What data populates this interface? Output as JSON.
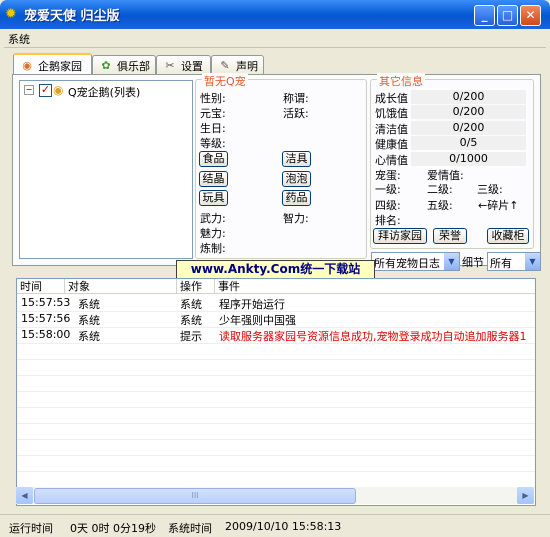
{
  "window": {
    "title": "宠爱天使 归尘版",
    "app_icon": "gear-icon"
  },
  "menu": {
    "items": [
      "系统"
    ]
  },
  "tabs": [
    {
      "label": "企鹅家园",
      "icon": "penguin-icon"
    },
    {
      "label": "俱乐部",
      "icon": "flower-icon"
    },
    {
      "label": "设置",
      "icon": "tools-icon"
    },
    {
      "label": "声明",
      "icon": "document-icon"
    }
  ],
  "tree": {
    "root_label": "Q宠企鹅(列表)"
  },
  "pet": {
    "group_title": "暂无Q宠",
    "fields": {
      "gender": "性别:",
      "title": "称谓:",
      "yuanbao": "元宝:",
      "activity": "活跃:",
      "birthday": "生日:",
      "level": "等级:",
      "force": "武力:",
      "intellect": "智力:",
      "charm": "魅力:",
      "refine": "炼制:"
    },
    "actions": {
      "food": "食品",
      "clean": "洁具",
      "crystal": "结晶",
      "bubble": "泡泡",
      "toy": "玩具",
      "medicine": "药品"
    }
  },
  "other": {
    "group_title": "其它信息",
    "stats": [
      {
        "label": "成长值",
        "value": "0/200"
      },
      {
        "label": "饥饿值",
        "value": "0/200"
      },
      {
        "label": "清洁值",
        "value": "0/200"
      },
      {
        "label": "健康值",
        "value": "0/5"
      },
      {
        "label": "心情值",
        "value": "0/1000"
      }
    ],
    "status_label": "宠蛋:",
    "love_label": "爱情值:",
    "grade1": "一级:",
    "grade2": "二级:",
    "grade3": "三级:",
    "grade4": "四级:",
    "grade5": "五级:",
    "shard": "←碎片↑",
    "rank": "排名:",
    "buttons": {
      "visit": "拜访家园",
      "honor": "荣誉",
      "cabinet": "收藏柜"
    }
  },
  "watermark": "www.Ankty.Com统一下载站",
  "filters": {
    "log_type": "所有宠物日志",
    "detail_label": "细节",
    "detail_value": "所有"
  },
  "log": {
    "columns": [
      "时间",
      "对象",
      "操作",
      "事件"
    ],
    "rows": [
      {
        "time": "15:57:53",
        "object": "系统",
        "op": "系统",
        "event": "程序开始运行",
        "color": "#000000"
      },
      {
        "time": "15:57:56",
        "object": "系统",
        "op": "系统",
        "event": "少年强则中国强",
        "color": "#000000"
      },
      {
        "time": "15:58:00",
        "object": "系统",
        "op": "提示",
        "event": "读取服务器家园号资源信息成功,宠物登录成功自动追加服务器1",
        "color": "#e00000"
      }
    ],
    "scroll_thumb_label": "III"
  },
  "statusbar": {
    "run_label": "运行时间",
    "run_value": "0天 0时 0分19秒",
    "sys_label": "系统时间",
    "sys_value": "2009/10/10 15:58:13"
  }
}
